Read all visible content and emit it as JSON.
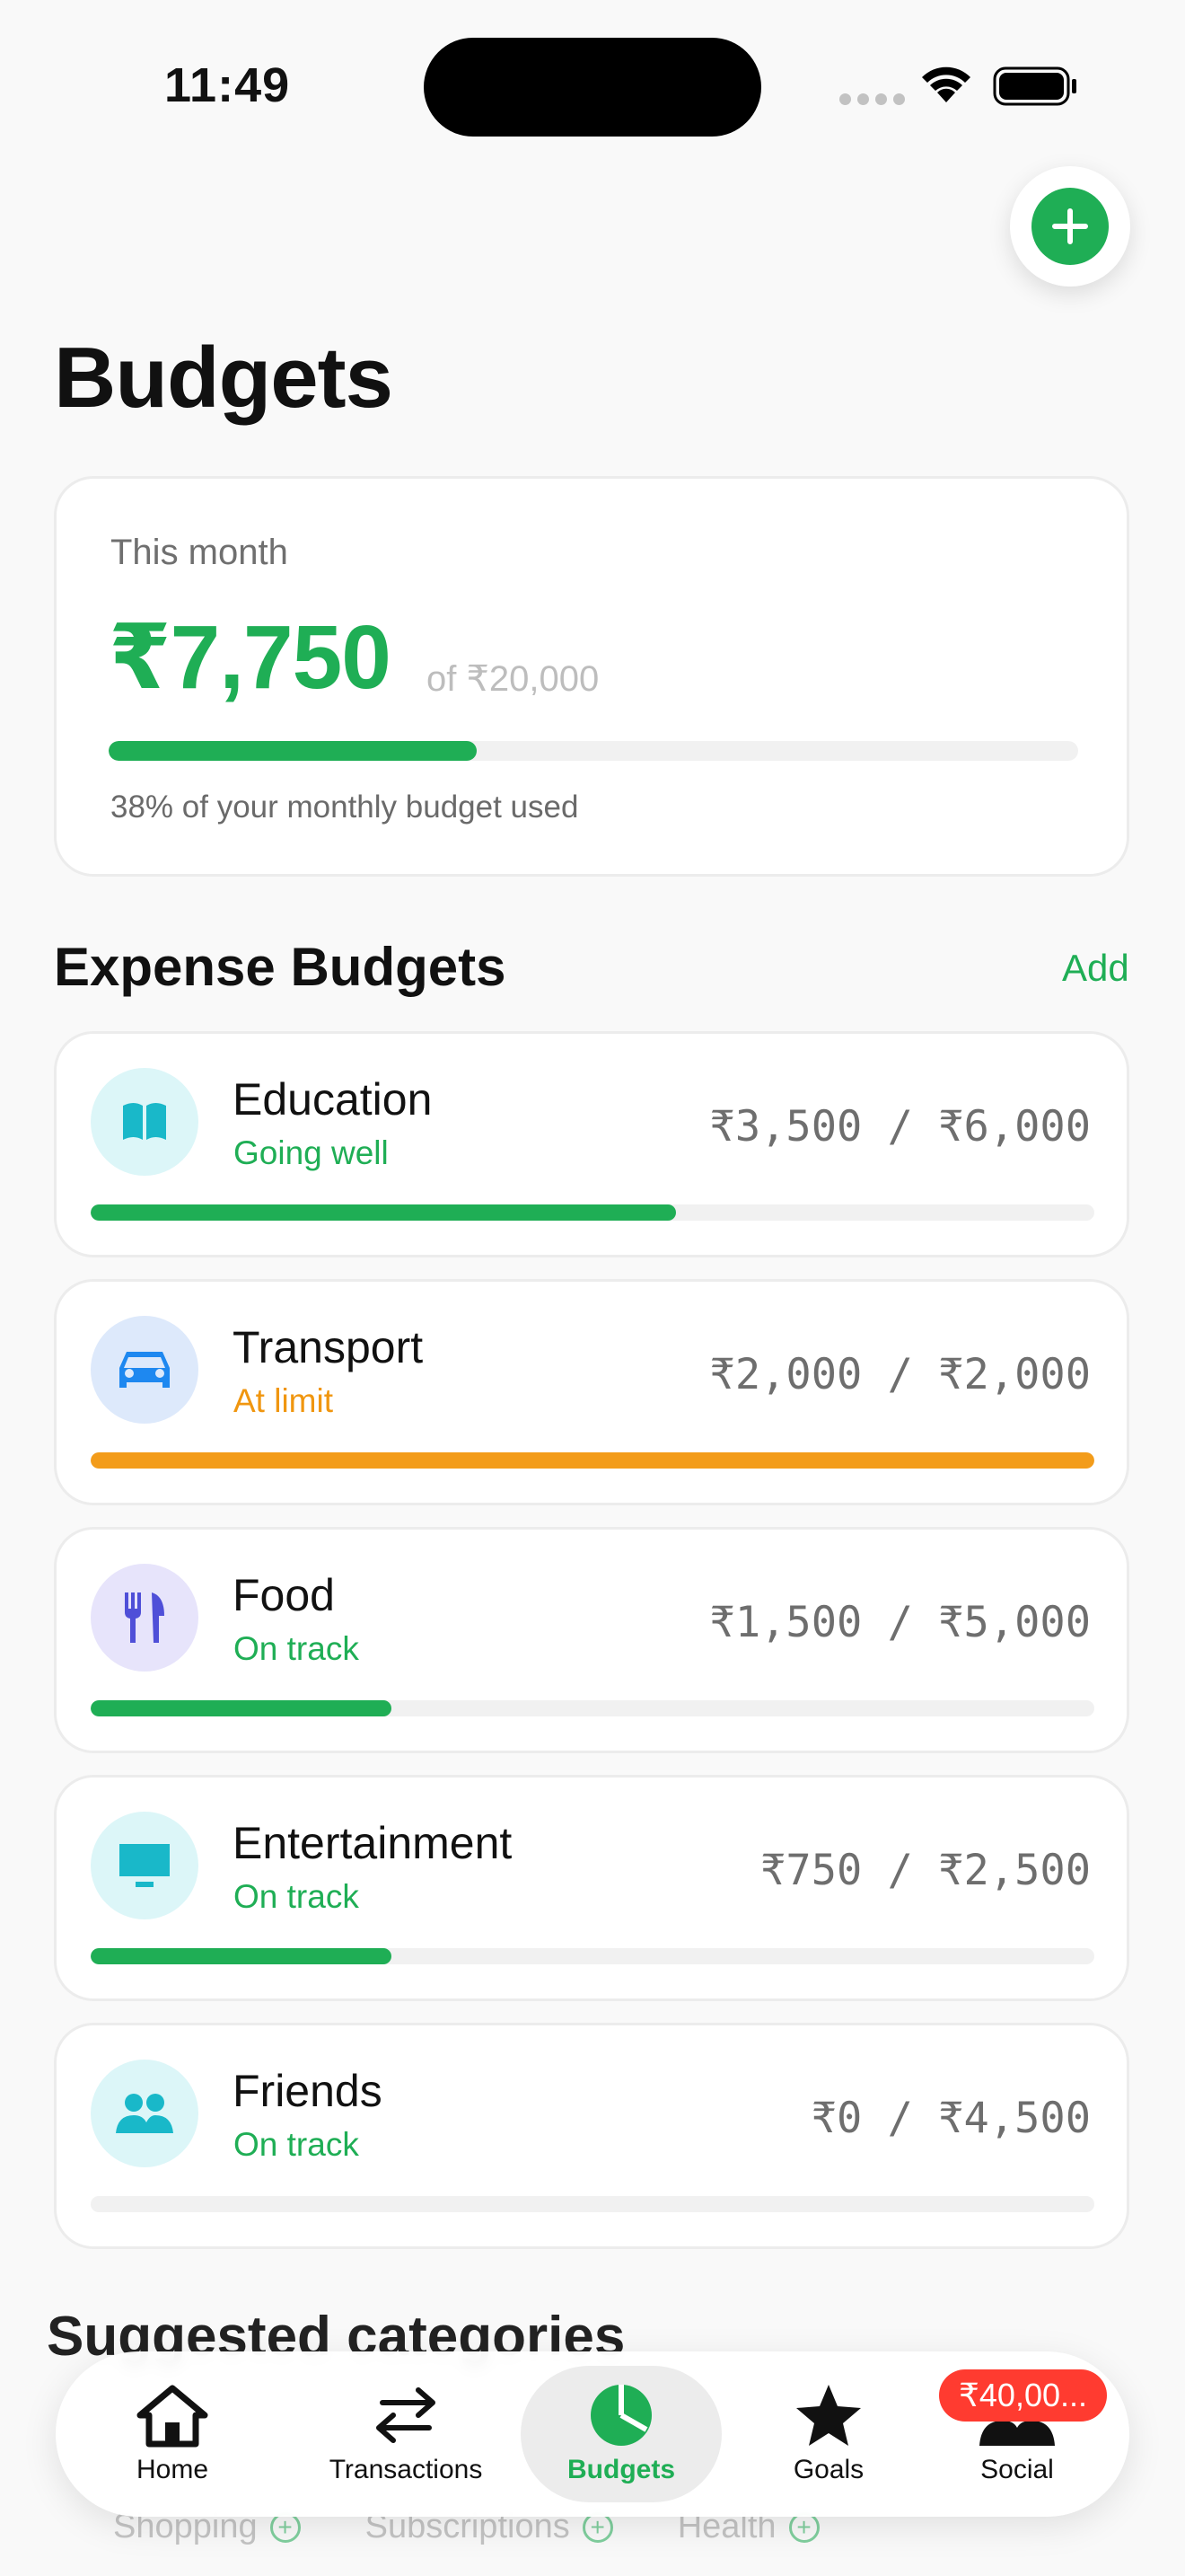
{
  "status_bar": {
    "time": "11:49"
  },
  "page": {
    "title": "Budgets"
  },
  "summary": {
    "label": "This month",
    "spent": "₹7,750",
    "total": "of ₹20,000",
    "progress": 0.38,
    "note": "38% of your monthly budget used"
  },
  "section": {
    "title": "Expense Budgets",
    "action": "Add"
  },
  "budgets": [
    {
      "name": "Education",
      "status": "Going well",
      "amount": "₹3,500 / ₹6,000",
      "progress": 0.5833,
      "icon": "book-icon",
      "status_color": "#1fae55",
      "bar_color": "#1fae55",
      "icon_bg": "#dcf6f8",
      "icon_color": "#19b8c9"
    },
    {
      "name": "Transport",
      "status": "At limit",
      "amount": "₹2,000 / ₹2,000",
      "progress": 1.0,
      "icon": "car-icon",
      "status_color": "#f0960f",
      "bar_color": "#f39c1a",
      "icon_bg": "#dde9fb",
      "icon_color": "#1e88f0"
    },
    {
      "name": "Food",
      "status": "On track",
      "amount": "₹1,500 / ₹5,000",
      "progress": 0.3,
      "icon": "fork-knife-icon",
      "status_color": "#1fae55",
      "bar_color": "#1fae55",
      "icon_bg": "#e7e4fb",
      "icon_color": "#4f4fd8"
    },
    {
      "name": "Entertainment",
      "status": "On track",
      "amount": "₹750 / ₹2,500",
      "progress": 0.3,
      "icon": "tv-icon",
      "status_color": "#1fae55",
      "bar_color": "#1fae55",
      "icon_bg": "#dcf6f8",
      "icon_color": "#19b8c9"
    },
    {
      "name": "Friends",
      "status": "On track",
      "amount": "₹0 / ₹4,500",
      "progress": 0.0,
      "icon": "people-icon",
      "status_color": "#1fae55",
      "bar_color": "#1fae55",
      "icon_bg": "#dcf6f8",
      "icon_color": "#19b8c9"
    }
  ],
  "suggested": {
    "title": "Suggested categories",
    "items": [
      "Shopping",
      "Subscriptions",
      "Health"
    ]
  },
  "tabbar": {
    "tabs": [
      {
        "label": "Home",
        "icon": "house-icon"
      },
      {
        "label": "Transactions",
        "icon": "arrows-icon"
      },
      {
        "label": "Budgets",
        "icon": "pie-chart-icon",
        "active": true
      },
      {
        "label": "Goals",
        "icon": "star-icon"
      },
      {
        "label": "Social",
        "icon": "people-icon"
      }
    ],
    "social_badge": "₹40,00..."
  },
  "colors": {
    "accent": "#1fae55",
    "warning": "#f39c1a",
    "badge": "#ff3b30"
  }
}
